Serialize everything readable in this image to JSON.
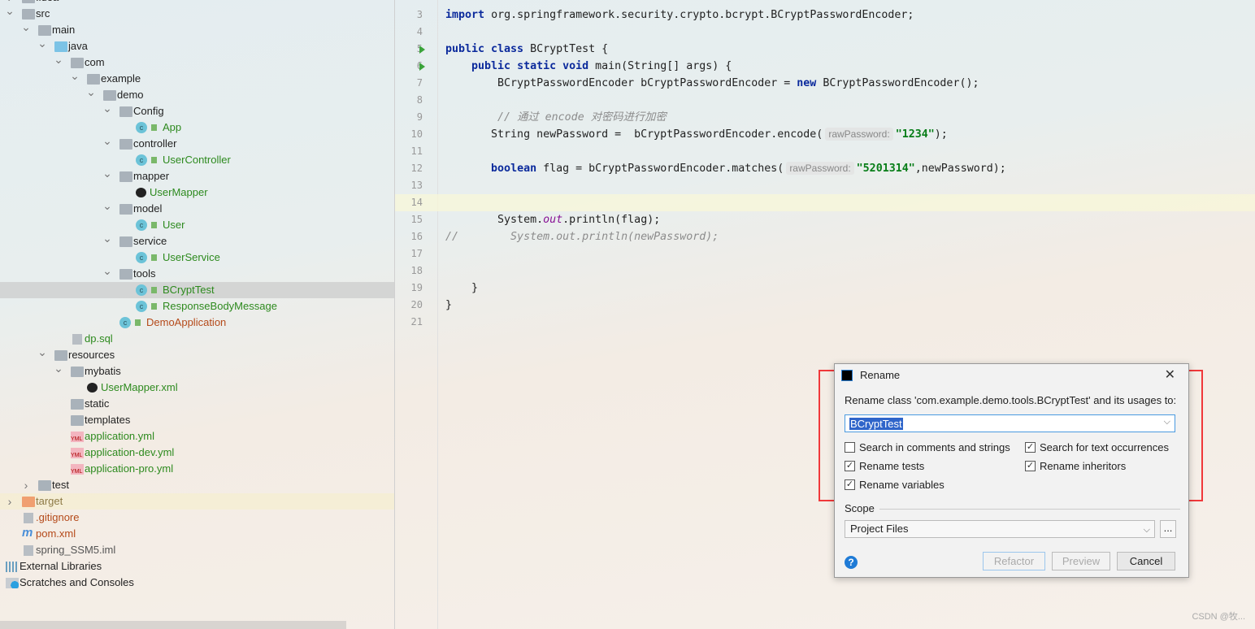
{
  "tree": [
    {
      "label": ".idea",
      "level": 0,
      "kind": "folder",
      "open": false,
      "color": ""
    },
    {
      "label": "src",
      "level": 0,
      "kind": "folder",
      "open": true
    },
    {
      "label": "main",
      "level": 1,
      "kind": "folder",
      "open": true
    },
    {
      "label": "java",
      "level": 2,
      "kind": "folder-java",
      "open": true
    },
    {
      "label": "com",
      "level": 3,
      "kind": "package",
      "open": true
    },
    {
      "label": "example",
      "level": 4,
      "kind": "package",
      "open": true
    },
    {
      "label": "demo",
      "level": 5,
      "kind": "package",
      "open": true
    },
    {
      "label": "Config",
      "level": 6,
      "kind": "package",
      "open": true
    },
    {
      "label": "App",
      "level": 7,
      "kind": "class",
      "color": "g"
    },
    {
      "label": "controller",
      "level": 6,
      "kind": "package",
      "open": true
    },
    {
      "label": "UserController",
      "level": 7,
      "kind": "class",
      "color": "g"
    },
    {
      "label": "mapper",
      "level": 6,
      "kind": "package",
      "open": true
    },
    {
      "label": "UserMapper",
      "level": 7,
      "kind": "mybatis",
      "color": "g"
    },
    {
      "label": "model",
      "level": 6,
      "kind": "package",
      "open": true
    },
    {
      "label": "User",
      "level": 7,
      "kind": "class",
      "color": "g"
    },
    {
      "label": "service",
      "level": 6,
      "kind": "package",
      "open": true
    },
    {
      "label": "UserService",
      "level": 7,
      "kind": "class",
      "color": "g"
    },
    {
      "label": "tools",
      "level": 6,
      "kind": "package",
      "open": true
    },
    {
      "label": "BCryptTest",
      "level": 7,
      "kind": "class-run",
      "color": "g",
      "selected": true
    },
    {
      "label": "ResponseBodyMessage",
      "level": 7,
      "kind": "class",
      "color": "g"
    },
    {
      "label": "DemoApplication",
      "level": 6,
      "kind": "class-run",
      "color": "r"
    },
    {
      "label": "dp.sql",
      "level": 3,
      "kind": "file",
      "color": "g"
    },
    {
      "label": "resources",
      "level": 2,
      "kind": "folder",
      "open": true
    },
    {
      "label": "mybatis",
      "level": 3,
      "kind": "folder",
      "open": true
    },
    {
      "label": "UserMapper.xml",
      "level": 4,
      "kind": "mybatis",
      "color": "g"
    },
    {
      "label": "static",
      "level": 3,
      "kind": "folder"
    },
    {
      "label": "templates",
      "level": 3,
      "kind": "folder"
    },
    {
      "label": "application.yml",
      "level": 3,
      "kind": "yml",
      "color": "g"
    },
    {
      "label": "application-dev.yml",
      "level": 3,
      "kind": "yml",
      "color": "g"
    },
    {
      "label": "application-pro.yml",
      "level": 3,
      "kind": "yml",
      "color": "g"
    },
    {
      "label": "test",
      "level": 1,
      "kind": "folder",
      "open": false
    },
    {
      "label": "target",
      "level": 0,
      "kind": "folder-target",
      "open": false,
      "color": "o",
      "highlight": true
    },
    {
      "label": ".gitignore",
      "level": 0,
      "kind": "file",
      "color": "r"
    },
    {
      "label": "pom.xml",
      "level": 0,
      "kind": "maven",
      "color": "r"
    },
    {
      "label": "spring_SSM5.iml",
      "level": 0,
      "kind": "file",
      "color": "gy"
    },
    {
      "label": "External Libraries",
      "level": -1,
      "kind": "libs"
    },
    {
      "label": "Scratches and Consoles",
      "level": -1,
      "kind": "scratches"
    }
  ],
  "editor": {
    "current_line": 14,
    "lines": [
      {
        "n": "3",
        "tokens": [
          [
            "kw",
            "import"
          ],
          [
            "",
            "org.springframework.security.crypto.bcrypt.BCryptPasswordEncoder;"
          ]
        ]
      },
      {
        "n": "4",
        "tokens": []
      },
      {
        "n": "5",
        "run": true,
        "tokens": [
          [
            "kw",
            "public class"
          ],
          [
            "",
            "BCryptTest {"
          ]
        ]
      },
      {
        "n": "6",
        "run": true,
        "tokens": [
          [
            "",
            "    "
          ],
          [
            "kw",
            "public static void"
          ],
          [
            "",
            " main(String[] args) {"
          ]
        ]
      },
      {
        "n": "7",
        "tokens": [
          [
            "",
            "        BCryptPasswordEncoder bCryptPasswordEncoder = "
          ],
          [
            "kw",
            "new"
          ],
          [
            "",
            " BCryptPasswordEncoder();"
          ]
        ]
      },
      {
        "n": "8",
        "tokens": []
      },
      {
        "n": "9",
        "tokens": [
          [
            "",
            "        "
          ],
          [
            "cm",
            "// 通过 encode 对密码进行加密"
          ]
        ]
      },
      {
        "n": "10",
        "tokens": [
          [
            "",
            "       String newPassword =  bCryptPasswordEncoder.encode("
          ],
          [
            "hint",
            "rawPassword:"
          ],
          [
            "st",
            "\"1234\""
          ],
          [
            "",
            ");"
          ]
        ]
      },
      {
        "n": "11",
        "tokens": []
      },
      {
        "n": "12",
        "tokens": [
          [
            "",
            "       "
          ],
          [
            "kw",
            "boolean"
          ],
          [
            "",
            " flag = bCryptPasswordEncoder.matches("
          ],
          [
            "hint",
            "rawPassword:"
          ],
          [
            "st",
            "\"5201314\""
          ],
          [
            "",
            ",newPassword);"
          ]
        ]
      },
      {
        "n": "13",
        "tokens": []
      },
      {
        "n": "14",
        "tokens": []
      },
      {
        "n": "15",
        "tokens": [
          [
            "",
            "        System."
          ],
          [
            "fi",
            "out"
          ],
          [
            "",
            ".println(flag);"
          ]
        ]
      },
      {
        "n": "16",
        "tokens": [
          [
            "cm",
            "//        System.out.println(newPassword);"
          ]
        ]
      },
      {
        "n": "17",
        "tokens": []
      },
      {
        "n": "18",
        "tokens": []
      },
      {
        "n": "19",
        "tokens": [
          [
            "",
            "    }"
          ]
        ]
      },
      {
        "n": "20",
        "tokens": [
          [
            "",
            "}"
          ]
        ]
      },
      {
        "n": "21",
        "tokens": []
      }
    ]
  },
  "dialog": {
    "title": "Rename",
    "prompt": "Rename class 'com.example.demo.tools.BCryptTest' and its usages to:",
    "new_name": "BCryptTest",
    "options": [
      {
        "label": "Search in comments and strings",
        "checked": false
      },
      {
        "label": "Search for text occurrences",
        "checked": true
      },
      {
        "label": "Rename tests",
        "checked": true
      },
      {
        "label": "Rename inheritors",
        "checked": true
      },
      {
        "label": "Rename variables",
        "checked": true
      }
    ],
    "scope_label": "Scope",
    "scope_value": "Project Files",
    "more_label": "...",
    "help_label": "?",
    "buttons": {
      "refactor": "Refactor",
      "preview": "Preview",
      "cancel": "Cancel"
    },
    "highlight_color": "#f0383a"
  },
  "watermark": "CSDN @牧..."
}
